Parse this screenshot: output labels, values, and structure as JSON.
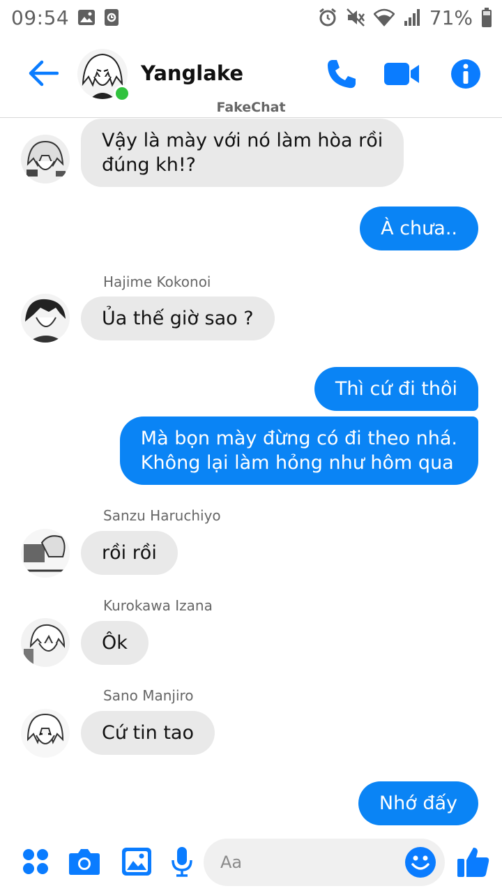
{
  "statusbar": {
    "time": "09:54",
    "battery": "71%"
  },
  "header": {
    "contact_name": "Yanglake",
    "watermark": "FakeChat"
  },
  "messages": [
    {
      "id": "m1",
      "direction": "in",
      "text": "Vậy là mày với nó làm hòa rồi\nđúng kh!?"
    },
    {
      "id": "m2",
      "direction": "out",
      "text": "À chưa.."
    },
    {
      "id": "m3",
      "direction": "in",
      "sender": "Hajime Kokonoi",
      "text": "Ủa thế giờ sao ?"
    },
    {
      "id": "m4",
      "direction": "out",
      "text": "Thì cứ đi thôi"
    },
    {
      "id": "m5",
      "direction": "out",
      "text": "Mà bọn mày đừng có đi theo nhá.\nKhông lại làm hỏng như hôm qua"
    },
    {
      "id": "m6",
      "direction": "in",
      "sender": "Sanzu Haruchiyo",
      "text": "rồi rồi"
    },
    {
      "id": "m7",
      "direction": "in",
      "sender": "Kurokawa Izana",
      "text": "Ôk"
    },
    {
      "id": "m8",
      "direction": "in",
      "sender": "Sano Manjiro",
      "text": "Cứ tin tao"
    },
    {
      "id": "m9",
      "direction": "out",
      "text": "Nhớ đấy"
    }
  ],
  "composer": {
    "placeholder": "Aa"
  },
  "colors": {
    "accent": "#0a84f5",
    "incoming_bubble": "#e9e9e9",
    "online": "#31c23e"
  },
  "icons": {
    "status_left": [
      "gallery-icon",
      "screenshot-icon"
    ],
    "status_right": [
      "alarm-icon",
      "mute-icon",
      "wifi-icon",
      "signal-icon",
      "battery-icon"
    ],
    "header": [
      "back-arrow-icon",
      "phone-icon",
      "video-icon",
      "info-icon"
    ],
    "composer": [
      "menu-dots-icon",
      "camera-icon",
      "image-icon",
      "microphone-icon",
      "emoji-icon",
      "thumbs-up-icon"
    ]
  }
}
